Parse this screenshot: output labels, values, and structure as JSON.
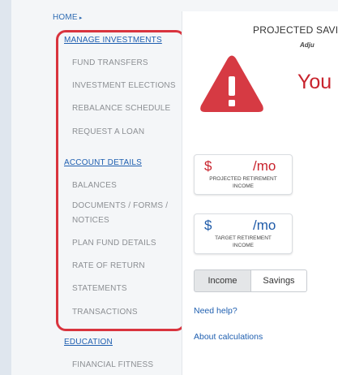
{
  "nav": {
    "home": "HOME",
    "home_arrow": "▸",
    "sections": [
      {
        "title": "MANAGE INVESTMENTS",
        "items": [
          "FUND TRANSFERS",
          "INVESTMENT ELECTIONS",
          "REBALANCE SCHEDULE",
          "REQUEST A LOAN"
        ]
      },
      {
        "title": "ACCOUNT DETAILS",
        "items": [
          "BALANCES",
          "DOCUMENTS / FORMS /",
          "NOTICES",
          "PLAN FUND DETAILS",
          "RATE OF RETURN",
          "STATEMENTS",
          "TRANSACTIONS"
        ]
      },
      {
        "title": "EDUCATION",
        "items": [
          "FINANCIAL FITNESS"
        ]
      }
    ]
  },
  "main": {
    "title": "PROJECTED SAVI",
    "adjust": "Adju",
    "alert_icon": "warning-triangle-icon",
    "alert_text": "You",
    "projected_card": {
      "dollar": "$",
      "per_month": "/mo",
      "label_line1": "PROJECTED RETIREMENT",
      "label_line2": "INCOME"
    },
    "target_card": {
      "dollar": "$",
      "per_month": "/mo",
      "label_line1": "TARGET RETIREMENT",
      "label_line2": "INCOME"
    },
    "toggle": {
      "income": "Income",
      "savings": "Savings"
    },
    "need_help": "Need help?",
    "about_calc": "About calculations"
  },
  "colors": {
    "accent_red": "#c8232d",
    "highlight_red": "#d9343e",
    "link_blue": "#1f5fb0",
    "nav_gray": "#8c8f93"
  }
}
